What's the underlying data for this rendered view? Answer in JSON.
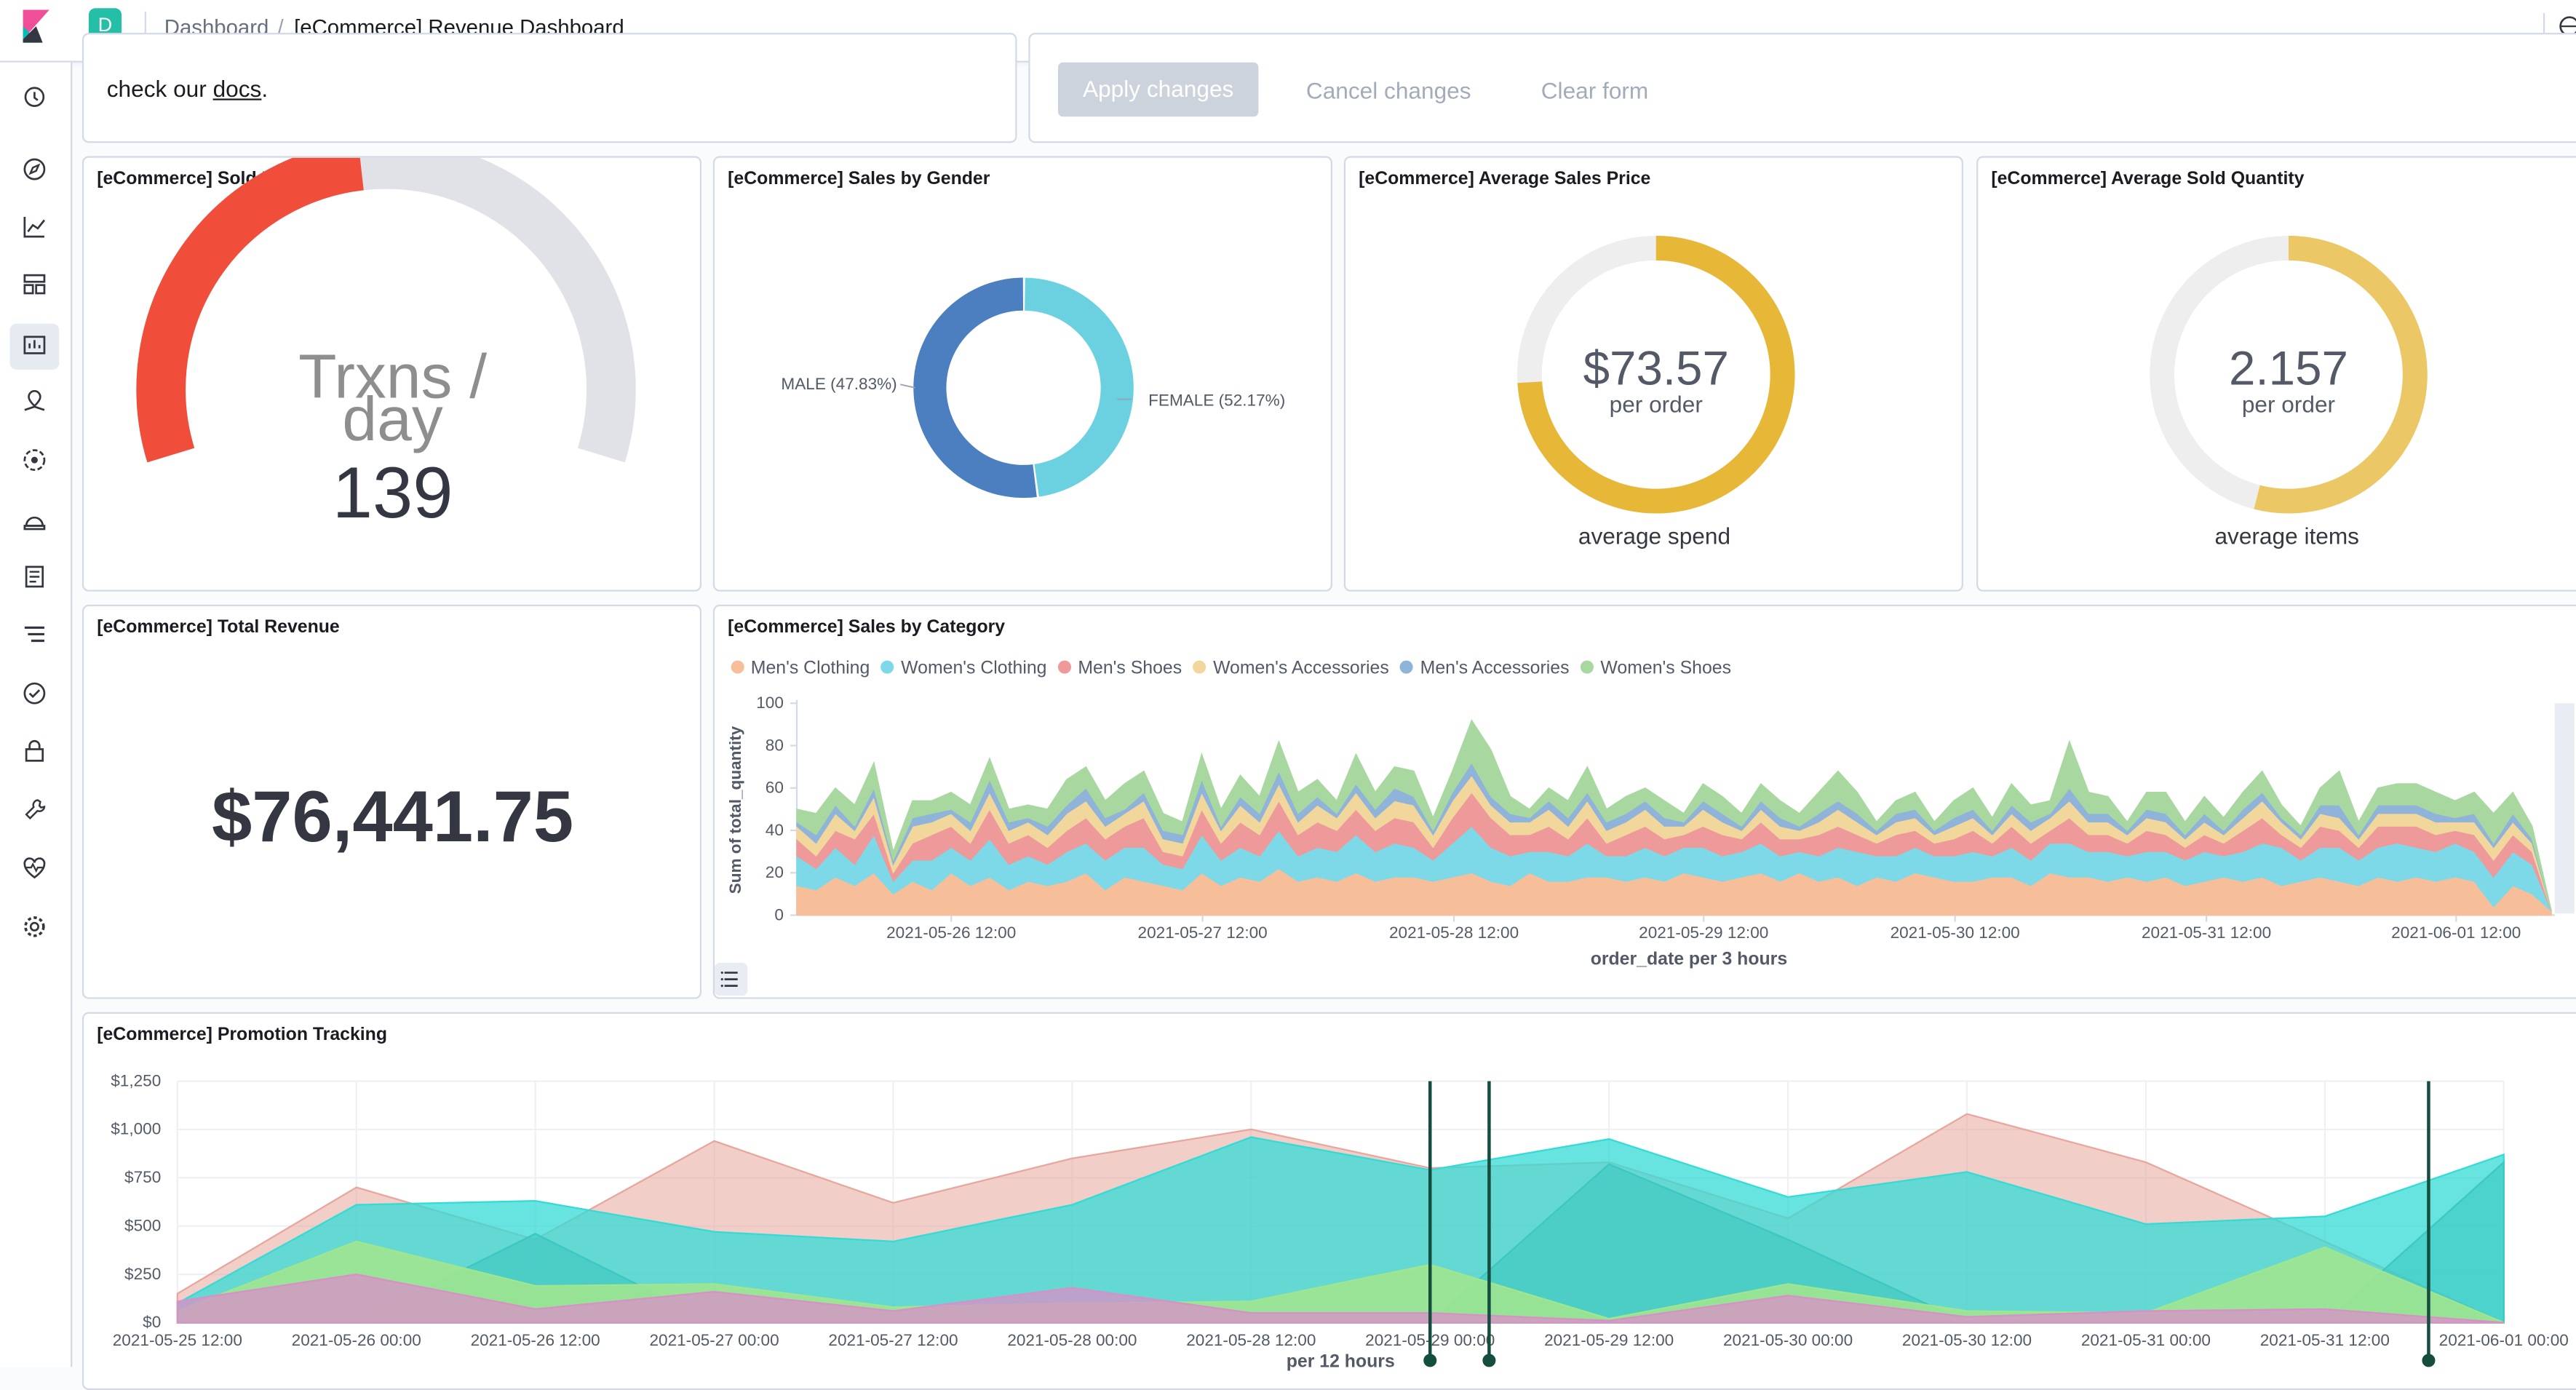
{
  "header": {
    "space_initial": "D",
    "breadcrumbs": [
      "Dashboard",
      "[eCommerce] Revenue Dashboard"
    ],
    "separator": "/"
  },
  "sidenav": {
    "items": [
      "clock-icon",
      "compass-icon",
      "visualize-icon",
      "dashboard-icon",
      "canvas-icon",
      "maps-icon",
      "ml-icon",
      "infrastructure-icon",
      "logs-icon",
      "apm-icon",
      "uptime-icon",
      "security-icon",
      "dev-tools-icon",
      "stack-monitoring-icon",
      "management-icon"
    ],
    "active": "dashboard-icon"
  },
  "controls": {
    "text_before": "check our ",
    "link": "docs",
    "text_after": ".",
    "apply": "Apply changes",
    "cancel": "Cancel changes",
    "clear": "Clear form"
  },
  "panels": {
    "sold_per_day": {
      "title": "[eCommerce] Sold Products per Day",
      "label_line1": "Trxns /",
      "label_line2": "day",
      "value": "139",
      "fill_fraction": 0.47
    },
    "sales_gender": {
      "title": "[eCommerce] Sales by Gender",
      "male_label": "MALE (47.83%)",
      "female_label": "FEMALE (52.17%)"
    },
    "avg_price": {
      "title": "[eCommerce] Average Sales Price",
      "value": "$73.57",
      "sub": "per order",
      "caption": "average spend",
      "fill_fraction": 0.74
    },
    "avg_qty": {
      "title": "[eCommerce] Average Sold Quantity",
      "value": "2.157",
      "sub": "per order",
      "caption": "average items",
      "fill_fraction": 0.54
    },
    "total_revenue": {
      "title": "[eCommerce] Total Revenue",
      "value": "$76,441.75"
    },
    "sales_category": {
      "title": "[eCommerce] Sales by Category"
    },
    "promotion": {
      "title": "[eCommerce] Promotion Tracking"
    }
  },
  "chart_data": [
    {
      "type": "pie",
      "title": "[eCommerce] Sales by Gender",
      "categories": [
        "MALE",
        "FEMALE"
      ],
      "values": [
        47.83,
        52.17
      ],
      "colors": [
        "#4c7fc0",
        "#6bd1e0"
      ]
    },
    {
      "type": "area",
      "title": "[eCommerce] Sales by Category",
      "xlabel": "order_date per 3 hours",
      "ylabel": "Sum of total_quantity",
      "ylim": [
        0,
        100
      ],
      "yticks": [
        "0",
        "20",
        "40",
        "60",
        "80",
        "100"
      ],
      "xticks": [
        "2021-05-26 12:00",
        "2021-05-27 12:00",
        "2021-05-28 12:00",
        "2021-05-29 12:00",
        "2021-05-30 12:00",
        "2021-05-31 12:00",
        "2021-06-01 12:00"
      ],
      "legend": "top",
      "stacked": true,
      "series": [
        {
          "name": "Men's Clothing",
          "color": "#f7be9a",
          "values": [
            14,
            12,
            18,
            14,
            20,
            10,
            16,
            12,
            20,
            14,
            18,
            12,
            16,
            14,
            16,
            20,
            12,
            18,
            16,
            14,
            12,
            20,
            14,
            18,
            16,
            22,
            16,
            18,
            16,
            20,
            16,
            18,
            18,
            16,
            18,
            20,
            16,
            14,
            20,
            16,
            16,
            18,
            18,
            16,
            18,
            16,
            20,
            18,
            16,
            18,
            20,
            16,
            20,
            16,
            18,
            14,
            18,
            16,
            20,
            18,
            16,
            16,
            18,
            18,
            14,
            20,
            18,
            18,
            16,
            18,
            16,
            18,
            14,
            16,
            18,
            16,
            18,
            14,
            16,
            18,
            16,
            14,
            18,
            16,
            18,
            16,
            18,
            16,
            4,
            14,
            10,
            2
          ]
        },
        {
          "name": "Women's Clothing",
          "color": "#7dd9e8",
          "values": [
            14,
            10,
            14,
            10,
            18,
            6,
            10,
            14,
            12,
            12,
            18,
            12,
            12,
            10,
            14,
            14,
            14,
            14,
            16,
            10,
            10,
            18,
            12,
            14,
            12,
            18,
            12,
            14,
            14,
            18,
            14,
            16,
            14,
            10,
            16,
            22,
            16,
            14,
            10,
            14,
            12,
            16,
            10,
            12,
            14,
            12,
            12,
            14,
            12,
            12,
            14,
            12,
            10,
            12,
            14,
            16,
            10,
            12,
            12,
            10,
            12,
            14,
            10,
            14,
            12,
            14,
            16,
            12,
            14,
            10,
            14,
            12,
            12,
            14,
            10,
            14,
            16,
            18,
            10,
            14,
            16,
            12,
            14,
            18,
            14,
            14,
            16,
            14,
            14,
            16,
            14,
            0
          ]
        },
        {
          "name": "Men's Shoes",
          "color": "#ee9a9a",
          "values": [
            8,
            6,
            8,
            12,
            10,
            4,
            8,
            12,
            10,
            8,
            14,
            10,
            10,
            8,
            10,
            12,
            10,
            10,
            14,
            6,
            6,
            12,
            8,
            12,
            10,
            14,
            10,
            12,
            10,
            12,
            10,
            12,
            12,
            6,
            12,
            16,
            14,
            10,
            8,
            12,
            8,
            12,
            6,
            10,
            10,
            8,
            6,
            10,
            10,
            6,
            10,
            8,
            6,
            10,
            10,
            8,
            6,
            10,
            8,
            6,
            8,
            10,
            6,
            10,
            8,
            6,
            12,
            8,
            8,
            6,
            10,
            8,
            6,
            8,
            6,
            10,
            12,
            6,
            6,
            10,
            8,
            6,
            10,
            8,
            10,
            8,
            6,
            8,
            8,
            8,
            6,
            0
          ]
        },
        {
          "name": "Women's Accessories",
          "color": "#f2d79c",
          "values": [
            6,
            6,
            8,
            4,
            8,
            4,
            8,
            6,
            6,
            6,
            8,
            6,
            6,
            6,
            8,
            8,
            6,
            6,
            8,
            6,
            6,
            8,
            6,
            8,
            6,
            8,
            6,
            8,
            6,
            8,
            6,
            8,
            8,
            6,
            8,
            8,
            6,
            6,
            6,
            8,
            6,
            8,
            6,
            6,
            8,
            6,
            4,
            8,
            6,
            4,
            6,
            6,
            4,
            6,
            8,
            6,
            4,
            6,
            6,
            4,
            6,
            6,
            4,
            6,
            6,
            6,
            8,
            6,
            6,
            4,
            6,
            6,
            4,
            6,
            4,
            6,
            8,
            6,
            4,
            6,
            6,
            4,
            6,
            6,
            6,
            6,
            4,
            6,
            6,
            6,
            4,
            0
          ]
        },
        {
          "name": "Men's Accessories",
          "color": "#8fb3d9",
          "values": [
            2,
            4,
            4,
            2,
            4,
            2,
            4,
            4,
            2,
            4,
            6,
            4,
            2,
            4,
            4,
            6,
            4,
            2,
            4,
            4,
            4,
            6,
            2,
            4,
            4,
            6,
            4,
            4,
            2,
            4,
            4,
            6,
            4,
            2,
            4,
            6,
            4,
            4,
            2,
            4,
            4,
            4,
            4,
            4,
            4,
            4,
            2,
            4,
            4,
            2,
            4,
            4,
            2,
            4,
            4,
            4,
            2,
            4,
            4,
            2,
            4,
            4,
            2,
            4,
            4,
            2,
            6,
            4,
            4,
            2,
            4,
            4,
            2,
            4,
            2,
            4,
            4,
            2,
            2,
            4,
            6,
            2,
            4,
            4,
            4,
            4,
            2,
            4,
            2,
            4,
            2,
            0
          ]
        },
        {
          "name": "Women's Shoes",
          "color": "#a8d8a0",
          "values": [
            6,
            10,
            8,
            10,
            12,
            4,
            8,
            6,
            8,
            8,
            10,
            6,
            6,
            8,
            12,
            10,
            8,
            12,
            10,
            8,
            6,
            12,
            8,
            10,
            8,
            14,
            10,
            8,
            6,
            14,
            8,
            10,
            12,
            6,
            10,
            20,
            22,
            8,
            4,
            6,
            8,
            12,
            6,
            8,
            6,
            8,
            4,
            8,
            8,
            6,
            8,
            8,
            6,
            10,
            14,
            10,
            4,
            6,
            8,
            4,
            8,
            10,
            6,
            10,
            8,
            6,
            22,
            10,
            8,
            4,
            8,
            10,
            6,
            8,
            6,
            8,
            10,
            6,
            4,
            8,
            16,
            6,
            8,
            10,
            10,
            10,
            8,
            10,
            14,
            10,
            6,
            0
          ]
        }
      ]
    },
    {
      "type": "area",
      "title": "[eCommerce] Promotion Tracking",
      "xlabel": "per 12 hours",
      "yticks": [
        "$0",
        "$250",
        "$500",
        "$750",
        "$1,000",
        "$1,250"
      ],
      "ylim": [
        0,
        1250
      ],
      "x": [
        "2021-05-25 12:00",
        "2021-05-26 00:00",
        "2021-05-26 12:00",
        "2021-05-27 00:00",
        "2021-05-27 12:00",
        "2021-05-28 00:00",
        "2021-05-28 12:00",
        "2021-05-29 00:00",
        "2021-05-29 12:00",
        "2021-05-30 00:00",
        "2021-05-30 12:00",
        "2021-05-31 00:00",
        "2021-05-31 12:00",
        "2021-06-01 00:00"
      ],
      "series": [
        {
          "color": "#e8a69c",
          "opacity": 0.55,
          "values": [
            150,
            700,
            430,
            940,
            620,
            850,
            1000,
            800,
            830,
            540,
            1080,
            830,
            420,
            0
          ]
        },
        {
          "color": "#34dbd6",
          "opacity": 0.75,
          "values": [
            100,
            610,
            630,
            470,
            420,
            610,
            960,
            790,
            950,
            650,
            780,
            510,
            550,
            870
          ]
        },
        {
          "color": "#3cc8c0",
          "opacity": 0.6,
          "values": [
            0,
            0,
            460,
            0,
            0,
            0,
            0,
            0,
            820,
            430,
            0,
            0,
            0,
            830
          ]
        },
        {
          "color": "#9ee68f",
          "opacity": 0.9,
          "values": [
            60,
            420,
            190,
            200,
            80,
            100,
            110,
            300,
            20,
            200,
            60,
            50,
            390,
            0
          ]
        },
        {
          "color": "#d98fc8",
          "opacity": 0.75,
          "values": [
            110,
            250,
            70,
            160,
            60,
            180,
            50,
            50,
            10,
            140,
            30,
            60,
            70,
            0
          ]
        }
      ],
      "annotations": [
        "2021-05-29 00:00",
        "2021-05-29 04:00",
        "2021-06-01 00:00"
      ]
    }
  ]
}
